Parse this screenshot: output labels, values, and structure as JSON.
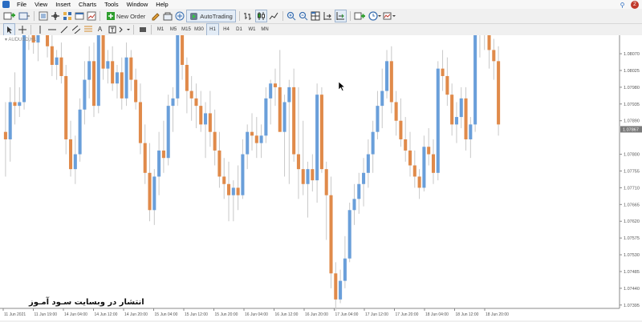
{
  "menu": {
    "items": [
      "File",
      "View",
      "Insert",
      "Charts",
      "Tools",
      "Window",
      "Help"
    ],
    "notification_count": "2"
  },
  "toolbar": {
    "new_order_label": "New Order",
    "autotrading_label": "AutoTrading"
  },
  "timeframes": [
    "M1",
    "M5",
    "M15",
    "M30",
    "H1",
    "H4",
    "D1",
    "W1",
    "MN"
  ],
  "active_timeframe": "H1",
  "chart": {
    "title": "AUDUSD,H1",
    "watermark": "انتشار در وبسایت سـود آمـوز",
    "colors": {
      "bull": "#6a9fda",
      "bear": "#e08a4a",
      "price_label_bg": "#7a7a7a"
    }
  },
  "chart_data": {
    "type": "candlestick",
    "symbol": "AUDUSD",
    "timeframe": "H1",
    "current_price": "1.07867",
    "ylim": [
      1.07386,
      1.08111
    ],
    "price_ticks": [
      "1.08070",
      "1.08025",
      "1.07980",
      "1.07935",
      "1.07890",
      "1.07800",
      "1.07755",
      "1.07710",
      "1.07665",
      "1.07620",
      "1.07575",
      "1.07530",
      "1.07485",
      "1.07440",
      "1.07395"
    ],
    "time_ticks": [
      "11 Jun 2021",
      "11 Jun 19:00",
      "14 Jun 04:00",
      "14 Jun 12:00",
      "14 Jun 20:00",
      "15 Jun 04:00",
      "15 Jun 12:00",
      "15 Jun 20:00",
      "16 Jun 04:00",
      "16 Jun 12:00",
      "16 Jun 20:00",
      "17 Jun 04:00",
      "17 Jun 12:00",
      "17 Jun 20:00",
      "18 Jun 04:00",
      "18 Jun 12:00",
      "18 Jun 20:00"
    ],
    "ohlc": [
      [
        1.0786,
        1.0794,
        1.0774,
        1.0784
      ],
      [
        1.0784,
        1.0798,
        1.0778,
        1.0794
      ],
      [
        1.0794,
        1.0802,
        1.0788,
        1.0793
      ],
      [
        1.0793,
        1.0798,
        1.079,
        1.0794
      ],
      [
        1.0794,
        1.0818,
        1.0792,
        1.0813
      ],
      [
        1.0813,
        1.0825,
        1.0808,
        1.0819
      ],
      [
        1.0819,
        1.0823,
        1.0807,
        1.081
      ],
      [
        1.081,
        1.082,
        1.0805,
        1.0816
      ],
      [
        1.0816,
        1.0822,
        1.0812,
        1.0818
      ],
      [
        1.0818,
        1.0821,
        1.0806,
        1.0809
      ],
      [
        1.0809,
        1.0812,
        1.0801,
        1.0804
      ],
      [
        1.0804,
        1.0808,
        1.08,
        1.0806
      ],
      [
        1.0806,
        1.081,
        1.0799,
        1.0801
      ],
      [
        1.0801,
        1.0804,
        1.078,
        1.0784
      ],
      [
        1.0784,
        1.0789,
        1.0774,
        1.0776
      ],
      [
        1.0776,
        1.0785,
        1.0772,
        1.078
      ],
      [
        1.078,
        1.0795,
        1.0778,
        1.0792
      ],
      [
        1.0792,
        1.0805,
        1.0788,
        1.08
      ],
      [
        1.08,
        1.0809,
        1.0795,
        1.0805
      ],
      [
        1.0805,
        1.081,
        1.079,
        1.0793
      ],
      [
        1.0793,
        1.0815,
        1.0791,
        1.0812
      ],
      [
        1.0812,
        1.0815,
        1.08,
        1.0803
      ],
      [
        1.0803,
        1.0808,
        1.0799,
        1.0805
      ],
      [
        1.0805,
        1.0809,
        1.0797,
        1.0799
      ],
      [
        1.0799,
        1.0804,
        1.0795,
        1.0802
      ],
      [
        1.0802,
        1.0806,
        1.0792,
        1.0795
      ],
      [
        1.0795,
        1.081,
        1.0793,
        1.0806
      ],
      [
        1.0806,
        1.0808,
        1.0797,
        1.08
      ],
      [
        1.08,
        1.0803,
        1.0792,
        1.0794
      ],
      [
        1.0794,
        1.0799,
        1.078,
        1.0783
      ],
      [
        1.0783,
        1.0788,
        1.0772,
        1.0775
      ],
      [
        1.0775,
        1.0783,
        1.0762,
        1.0765
      ],
      [
        1.0765,
        1.0776,
        1.0761,
        1.0774
      ],
      [
        1.0774,
        1.0786,
        1.0769,
        1.0781
      ],
      [
        1.0781,
        1.0789,
        1.0775,
        1.0779
      ],
      [
        1.0779,
        1.0796,
        1.0777,
        1.0793
      ],
      [
        1.0793,
        1.0798,
        1.0786,
        1.0795
      ],
      [
        1.0795,
        1.0817,
        1.0793,
        1.0814
      ],
      [
        1.0814,
        1.0818,
        1.08,
        1.0804
      ],
      [
        1.0804,
        1.0806,
        1.0791,
        1.0797
      ],
      [
        1.0797,
        1.0801,
        1.0789,
        1.0795
      ],
      [
        1.0795,
        1.0799,
        1.0787,
        1.0793
      ],
      [
        1.0793,
        1.0797,
        1.0786,
        1.0788
      ],
      [
        1.0788,
        1.0794,
        1.0779,
        1.0791
      ],
      [
        1.0791,
        1.0797,
        1.0782,
        1.0786
      ],
      [
        1.0786,
        1.0792,
        1.0777,
        1.0781
      ],
      [
        1.0781,
        1.0786,
        1.0771,
        1.0774
      ],
      [
        1.0774,
        1.0779,
        1.0768,
        1.0772
      ],
      [
        1.0772,
        1.0778,
        1.0762,
        1.0769
      ],
      [
        1.0769,
        1.0773,
        1.0762,
        1.0771
      ],
      [
        1.0771,
        1.0777,
        1.0765,
        1.0769
      ],
      [
        1.0769,
        1.0784,
        1.0768,
        1.078
      ],
      [
        1.078,
        1.0788,
        1.0776,
        1.0786
      ],
      [
        1.0786,
        1.0791,
        1.0781,
        1.0785
      ],
      [
        1.0785,
        1.079,
        1.0779,
        1.0783
      ],
      [
        1.0783,
        1.0788,
        1.0779,
        1.0785
      ],
      [
        1.0785,
        1.0798,
        1.0783,
        1.0795
      ],
      [
        1.0795,
        1.08,
        1.0788,
        1.0799
      ],
      [
        1.0799,
        1.0803,
        1.0793,
        1.0798
      ],
      [
        1.0798,
        1.0808,
        1.0786,
        1.0786
      ],
      [
        1.0786,
        1.0796,
        1.0774,
        1.0794
      ],
      [
        1.0794,
        1.08,
        1.0772,
        1.0798
      ],
      [
        1.0798,
        1.0803,
        1.0778,
        1.078
      ],
      [
        1.078,
        1.0798,
        1.0768,
        1.0776
      ],
      [
        1.0776,
        1.0789,
        1.0769,
        1.0772
      ],
      [
        1.0772,
        1.0778,
        1.0763,
        1.0776
      ],
      [
        1.0776,
        1.078,
        1.077,
        1.0773
      ],
      [
        1.0773,
        1.0799,
        1.0767,
        1.0796
      ],
      [
        1.0796,
        1.0798,
        1.0775,
        1.0776
      ],
      [
        1.0776,
        1.0778,
        1.0757,
        1.0769
      ],
      [
        1.0769,
        1.0774,
        1.0744,
        1.0748
      ],
      [
        1.0748,
        1.0751,
        1.0738,
        1.0741
      ],
      [
        1.0741,
        1.0749,
        1.074,
        1.0746
      ],
      [
        1.0746,
        1.0758,
        1.0744,
        1.0752
      ],
      [
        1.0752,
        1.0767,
        1.0751,
        1.0765
      ],
      [
        1.0765,
        1.0772,
        1.0761,
        1.0768
      ],
      [
        1.0768,
        1.0775,
        1.0764,
        1.0772
      ],
      [
        1.0772,
        1.0779,
        1.0766,
        1.0775
      ],
      [
        1.0775,
        1.0784,
        1.0771,
        1.078
      ],
      [
        1.078,
        1.0789,
        1.0775,
        1.0786
      ],
      [
        1.0786,
        1.0797,
        1.0784,
        1.0793
      ],
      [
        1.0793,
        1.0803,
        1.0787,
        1.0797
      ],
      [
        1.0797,
        1.0808,
        1.0795,
        1.0805
      ],
      [
        1.0805,
        1.0809,
        1.0791,
        1.0794
      ],
      [
        1.0794,
        1.0797,
        1.0785,
        1.0789
      ],
      [
        1.0789,
        1.0795,
        1.0782,
        1.0784
      ],
      [
        1.0784,
        1.079,
        1.0778,
        1.0781
      ],
      [
        1.0781,
        1.0786,
        1.0774,
        1.0777
      ],
      [
        1.0777,
        1.0781,
        1.0771,
        1.0774
      ],
      [
        1.0774,
        1.0776,
        1.0768,
        1.0771
      ],
      [
        1.0771,
        1.0785,
        1.077,
        1.0782
      ],
      [
        1.0782,
        1.0787,
        1.0777,
        1.078
      ],
      [
        1.078,
        1.0784,
        1.0772,
        1.0775
      ],
      [
        1.0775,
        1.0805,
        1.0773,
        1.0803
      ],
      [
        1.0803,
        1.0808,
        1.0797,
        1.0801
      ],
      [
        1.0801,
        1.0806,
        1.0793,
        1.0796
      ],
      [
        1.0796,
        1.0799,
        1.0785,
        1.0788
      ],
      [
        1.0788,
        1.0794,
        1.0783,
        1.079
      ],
      [
        1.079,
        1.0798,
        1.0787,
        1.0795
      ],
      [
        1.0795,
        1.0798,
        1.0781,
        1.0784
      ],
      [
        1.0784,
        1.079,
        1.0779,
        1.0788
      ],
      [
        1.0788,
        1.0819,
        1.0786,
        1.0815
      ],
      [
        1.0815,
        1.0821,
        1.0806,
        1.0819
      ],
      [
        1.0819,
        1.0822,
        1.0808,
        1.0812
      ],
      [
        1.0812,
        1.0815,
        1.0803,
        1.0808
      ],
      [
        1.0808,
        1.0811,
        1.08,
        1.0805
      ],
      [
        1.0805,
        1.0809,
        1.0785,
        1.0788
      ]
    ]
  }
}
